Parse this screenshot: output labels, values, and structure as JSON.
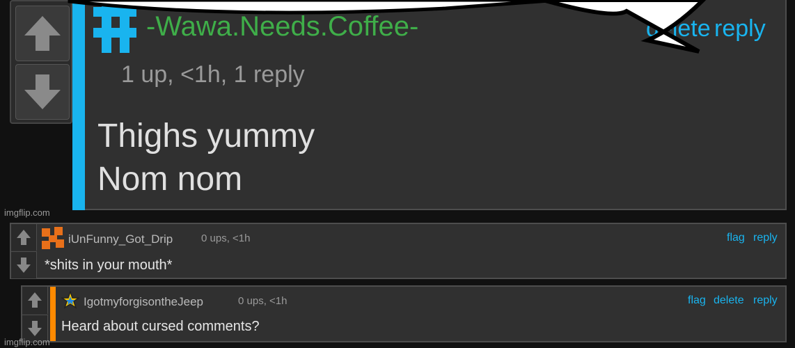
{
  "big_comment": {
    "username": "-Wawa.Needs.Coffee-",
    "meta": "1 up, <1h, 1 reply",
    "actions": {
      "delete": "delete",
      "reply": "reply"
    },
    "text_line1": "Thighs yummy",
    "text_line2": "Nom nom",
    "accent": "#19b4ef",
    "username_color": "#3fae49"
  },
  "watermark": "imgflip.com",
  "comments": [
    {
      "username": "iUnFunny_Got_Drip",
      "meta": "0 ups, <1h",
      "flag": "flag",
      "reply": "reply",
      "text": "*shits in your mouth*",
      "avatar_icon": "orange-pixel-avatar-icon"
    },
    {
      "username": "IgotmyforgisontheJeep",
      "meta": "0 ups, <1h",
      "flag": "flag",
      "delete": "delete",
      "reply": "reply",
      "text": "Heard about cursed comments?",
      "avatar_icon": "rainbow-star-avatar-icon",
      "accent": "#ff8a00"
    }
  ],
  "icons": {
    "upvote": "arrow-up-icon",
    "downvote": "arrow-down-icon"
  }
}
